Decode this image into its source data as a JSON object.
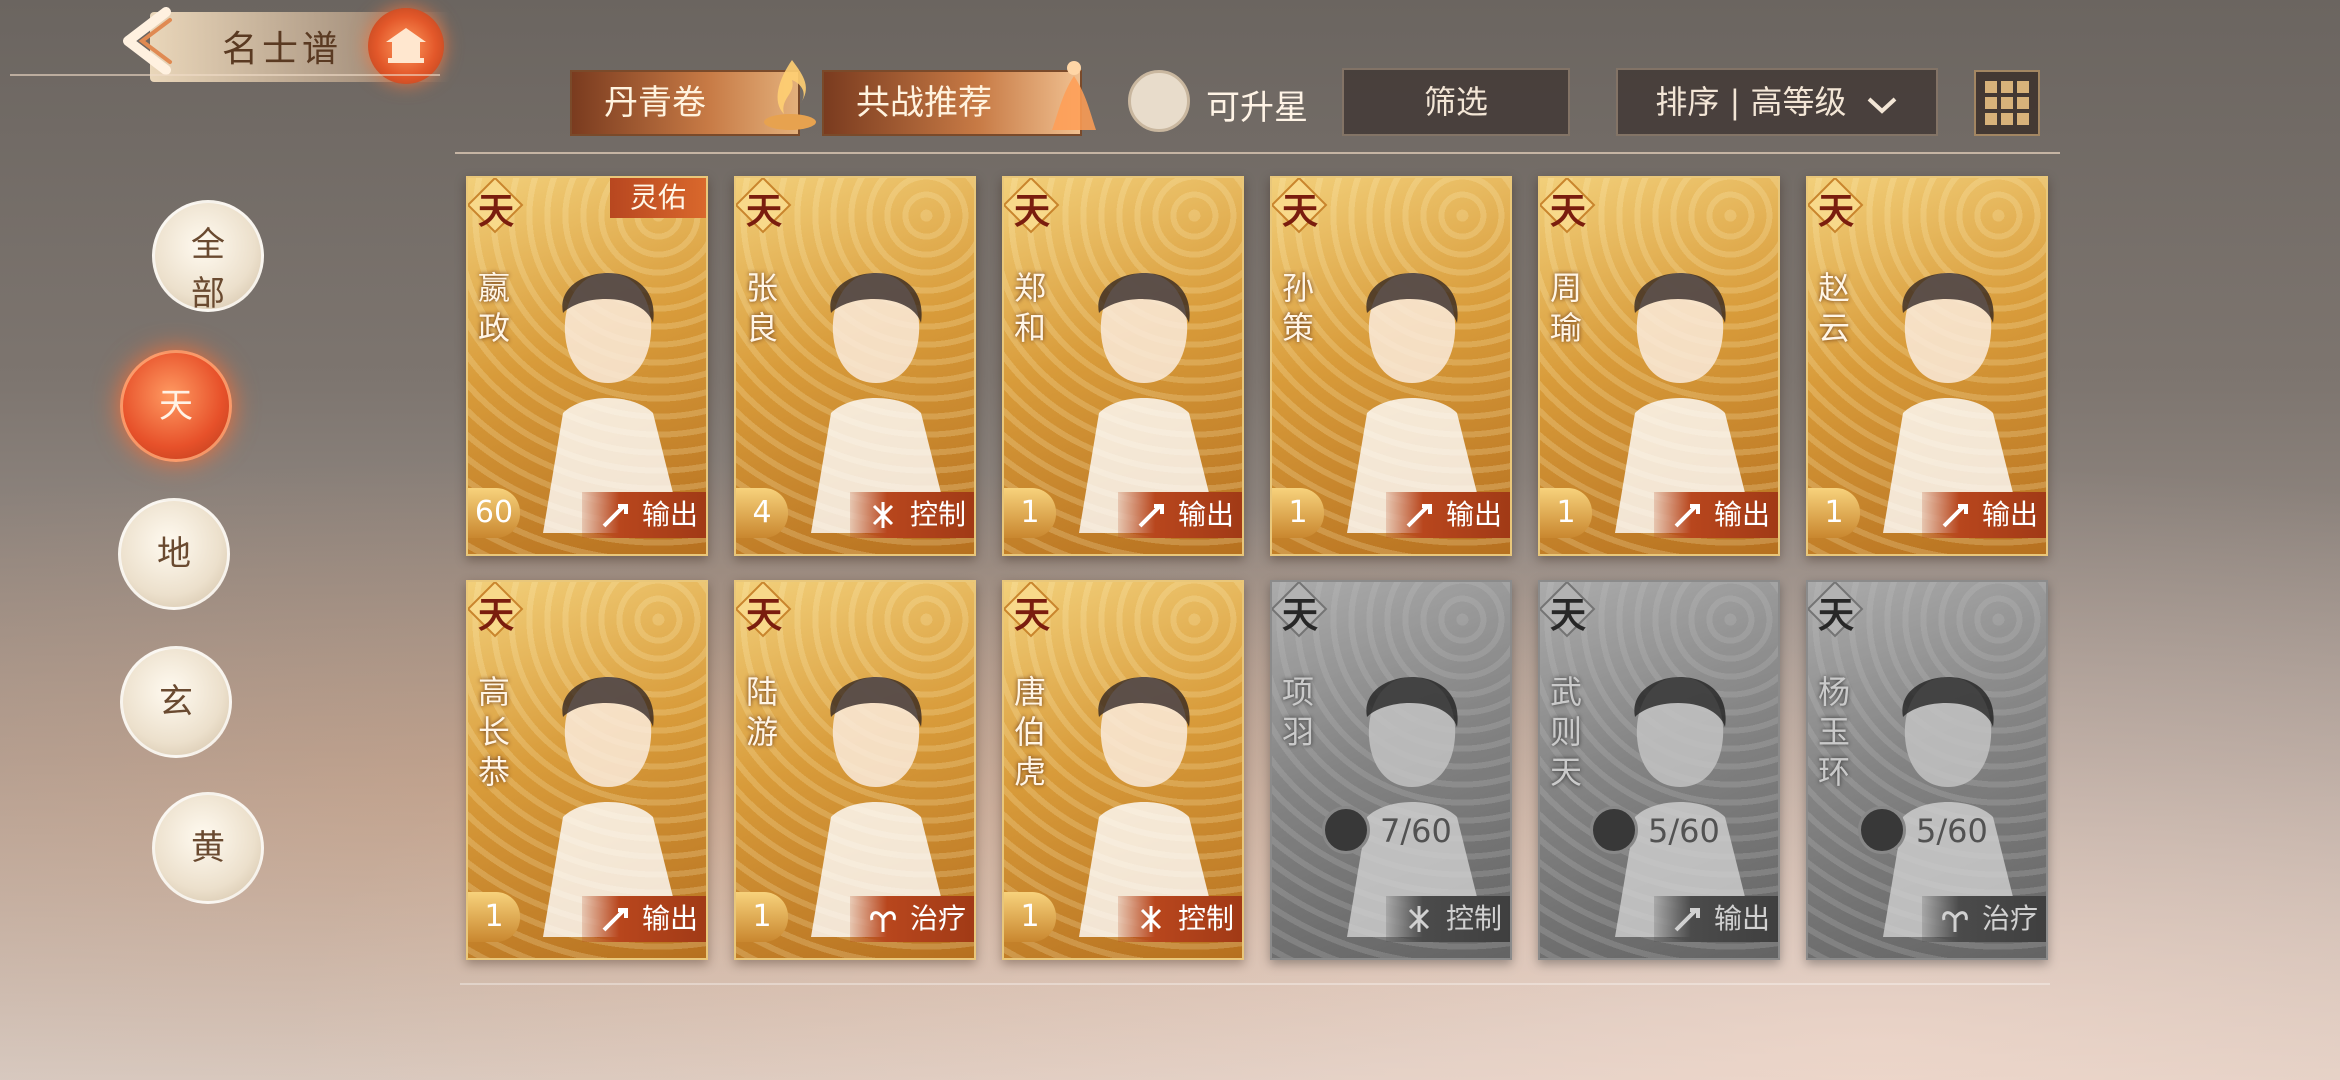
{
  "header": {
    "title": "名士谱"
  },
  "toolbar": {
    "tab_scroll": "丹青卷",
    "tab_recommend": "共战推荐",
    "star_label": "可升星",
    "filter_label": "筛选",
    "sort_label": "排序 | 高等级"
  },
  "ranks": [
    {
      "label_top": "全",
      "label_bottom": "部"
    },
    {
      "label_top": "天",
      "label_bottom": ""
    },
    {
      "label_top": "地",
      "label_bottom": ""
    },
    {
      "label_top": "玄",
      "label_bottom": ""
    },
    {
      "label_top": "黄",
      "label_bottom": ""
    }
  ],
  "active_rank": "天",
  "cards": [
    {
      "grade": "天",
      "name_chars": [
        "嬴",
        "政"
      ],
      "level": "60",
      "role": "输出",
      "tag": "灵佑",
      "locked": false
    },
    {
      "grade": "天",
      "name_chars": [
        "张",
        "良"
      ],
      "level": "4",
      "role": "控制",
      "locked": false
    },
    {
      "grade": "天",
      "name_chars": [
        "郑",
        "和"
      ],
      "level": "1",
      "role": "输出",
      "locked": false
    },
    {
      "grade": "天",
      "name_chars": [
        "孙",
        "策"
      ],
      "level": "1",
      "role": "输出",
      "locked": false
    },
    {
      "grade": "天",
      "name_chars": [
        "周",
        "瑜"
      ],
      "level": "1",
      "role": "输出",
      "locked": false
    },
    {
      "grade": "天",
      "name_chars": [
        "赵",
        "云"
      ],
      "level": "1",
      "role": "输出",
      "locked": false
    },
    {
      "grade": "天",
      "name_chars": [
        "高",
        "长",
        "恭"
      ],
      "level": "1",
      "role": "输出",
      "locked": false
    },
    {
      "grade": "天",
      "name_chars": [
        "陆",
        "游"
      ],
      "level": "1",
      "role": "治疗",
      "locked": false
    },
    {
      "grade": "天",
      "name_chars": [
        "唐",
        "伯",
        "虎"
      ],
      "level": "1",
      "role": "控制",
      "locked": false
    },
    {
      "grade": "天",
      "name_chars": [
        "项",
        "羽"
      ],
      "fragments": "7/60",
      "role": "控制",
      "locked": true
    },
    {
      "grade": "天",
      "name_chars": [
        "武",
        "则",
        "天"
      ],
      "fragments": "5/60",
      "role": "输出",
      "locked": true
    },
    {
      "grade": "天",
      "name_chars": [
        "杨",
        "玉",
        "环"
      ],
      "fragments": "5/60",
      "role": "治疗",
      "locked": true
    }
  ],
  "colors": {
    "accent": "#e7512a",
    "role_bar": "#b8461d",
    "card_gold": "#d89b3a",
    "fragment_red": "#e03a2a"
  }
}
